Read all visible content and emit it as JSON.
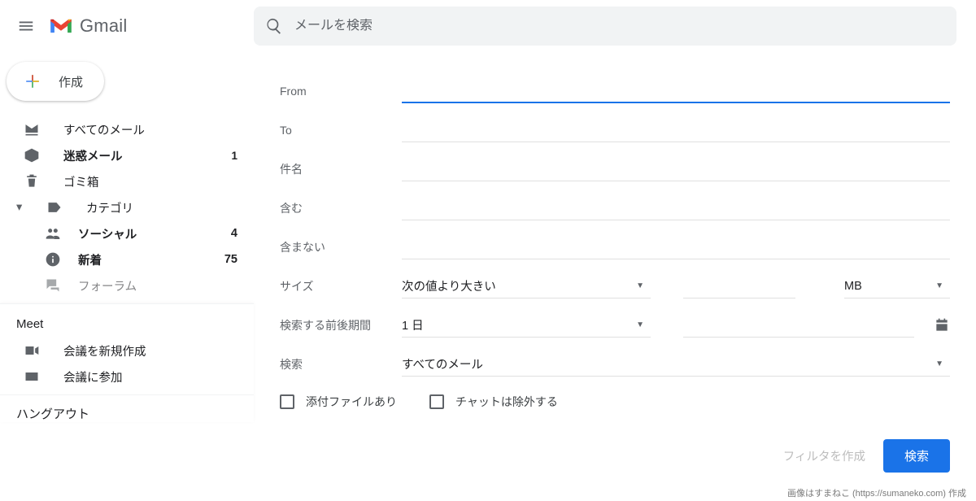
{
  "brand": "Gmail",
  "search": {
    "placeholder": "メールを検索"
  },
  "compose": {
    "label": "作成"
  },
  "sidebar": {
    "items": [
      {
        "label": "すべてのメール",
        "count": "",
        "bold": false,
        "icon": "stack"
      },
      {
        "label": "迷惑メール",
        "count": "1",
        "bold": true,
        "icon": "alert"
      },
      {
        "label": "ゴミ箱",
        "count": "",
        "bold": false,
        "icon": "trash"
      },
      {
        "label": "カテゴリ",
        "count": "",
        "bold": false,
        "icon": "tag",
        "expandable": true
      }
    ],
    "subs": [
      {
        "label": "ソーシャル",
        "count": "4",
        "bold": true,
        "icon": "people"
      },
      {
        "label": "新着",
        "count": "75",
        "bold": true,
        "icon": "info"
      },
      {
        "label": "フォーラム",
        "count": "",
        "bold": false,
        "icon": "forum"
      }
    ],
    "meet": {
      "caption": "Meet",
      "items": [
        {
          "label": "会議を新規作成",
          "icon": "video"
        },
        {
          "label": "会議に参加",
          "icon": "keyboard"
        }
      ]
    },
    "hangout_caption": "ハングアウト"
  },
  "form": {
    "labels": {
      "from": "From",
      "to": "To",
      "subject": "件名",
      "contains": "含む",
      "not_contains": "含まない",
      "size": "サイズ",
      "date": "検索する前後期間",
      "location": "検索"
    },
    "size_op": "次の値より大きい",
    "size_unit": "MB",
    "date_value": "1 日",
    "location_value": "すべてのメール",
    "attach_label": "添付ファイルあり",
    "chat_label": "チャットは除外する",
    "filter_btn": "フィルタを作成",
    "search_btn": "検索"
  },
  "credit": "画像はすまねこ (https://sumaneko.com) 作成"
}
